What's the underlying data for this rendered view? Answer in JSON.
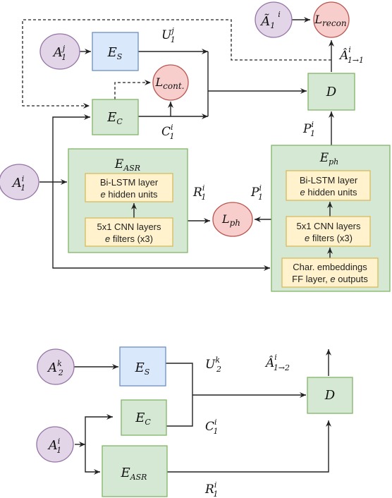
{
  "colors": {
    "input_fill": "#e1d5e7",
    "input_stroke": "#9673a6",
    "speaker_fill": "#dae8fc",
    "speaker_stroke": "#6c8ebf",
    "module_fill": "#d5e8d4",
    "module_stroke": "#82b366",
    "loss_fill": "#f8cecc",
    "loss_stroke": "#b85450",
    "layer_fill": "#fff2cc",
    "layer_stroke": "#d6b656"
  },
  "training": {
    "inputs": {
      "a1j": {
        "base": "A",
        "sub": "1",
        "sup": "j"
      },
      "a1i": {
        "base": "A",
        "sub": "1",
        "sup": "i"
      },
      "a1i_tilde": {
        "base": "Ã",
        "sub": "1",
        "sup": "i"
      }
    },
    "modules": {
      "es": {
        "base": "E",
        "sub": "S"
      },
      "ec": {
        "base": "E",
        "sub": "C"
      },
      "easr": {
        "base": "E",
        "sub": "ASR",
        "layers": [
          {
            "line1": "Bi-LSTM layer",
            "line2_em": "e",
            "line2": " hidden units"
          },
          {
            "line1": "5x1 CNN layers",
            "line2_em": "e",
            "line2": " filters (x3)"
          }
        ]
      },
      "eph": {
        "base": "E",
        "sub": "ph",
        "layers": [
          {
            "line1": "Bi-LSTM layer",
            "line2_em": "e",
            "line2": " hidden units"
          },
          {
            "line1": "5x1 CNN layers",
            "line2_em": "e",
            "line2": " filters (x3)"
          },
          {
            "line1": "Char. embeddings",
            "line2_pre": "FF layer, ",
            "line2_em": "e",
            "line2": " outputs"
          }
        ]
      },
      "d": {
        "base": "D"
      }
    },
    "losses": {
      "recon": {
        "base": "L",
        "sub": "recon"
      },
      "cont": {
        "base": "L",
        "sub": "cont."
      },
      "ph": {
        "base": "L",
        "sub": "ph"
      }
    },
    "edge_labels": {
      "u1j": {
        "base": "U",
        "sub": "1",
        "sup": "j"
      },
      "c1i": {
        "base": "C",
        "sub": "1",
        "sup": "i"
      },
      "r1i": {
        "base": "R",
        "sub": "1",
        "sup": "i"
      },
      "p1i_left": {
        "base": "P",
        "sub": "1",
        "sup": "i"
      },
      "p1i_up": {
        "base": "P",
        "sub": "1",
        "sup": "i"
      },
      "a_hat_11": {
        "base": "Â",
        "sub": "1→1",
        "sup": "i"
      }
    }
  },
  "inference": {
    "inputs": {
      "a2k": {
        "base": "A",
        "sub": "2",
        "sup": "k"
      },
      "a1i": {
        "base": "A",
        "sub": "1",
        "sup": "i"
      }
    },
    "modules": {
      "es": {
        "base": "E",
        "sub": "S"
      },
      "ec": {
        "base": "E",
        "sub": "C"
      },
      "easr": {
        "base": "E",
        "sub": "ASR"
      },
      "d": {
        "base": "D"
      }
    },
    "edge_labels": {
      "u2k": {
        "base": "U",
        "sub": "2",
        "sup": "k"
      },
      "c1i": {
        "base": "C",
        "sub": "1",
        "sup": "i"
      },
      "r1i": {
        "base": "R",
        "sub": "1",
        "sup": "i"
      },
      "a_hat_12": {
        "base": "Â",
        "sub": "1→2",
        "sup": "i"
      }
    }
  }
}
